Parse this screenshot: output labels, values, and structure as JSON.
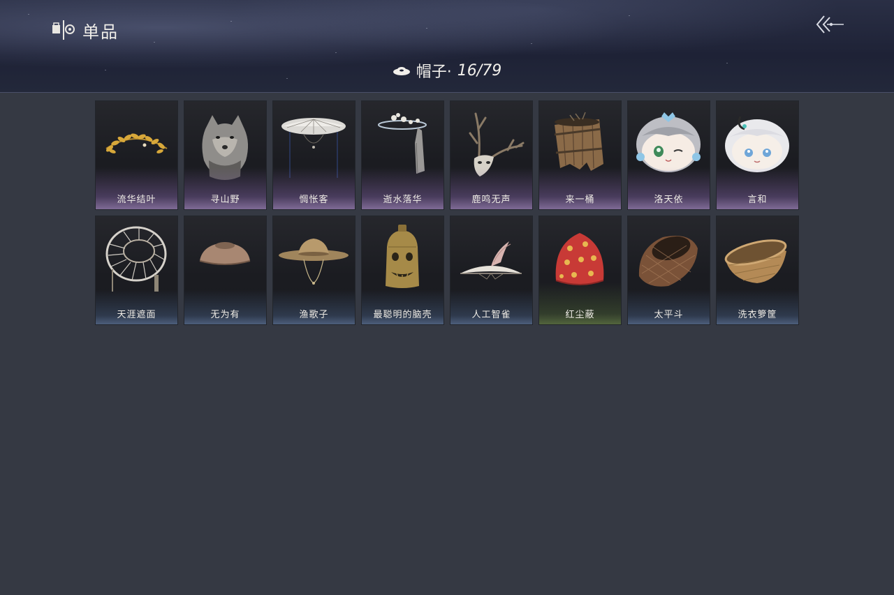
{
  "header": {
    "title": "单品",
    "title_icon": "collection-icon",
    "back_icon": "back-arrow-icon"
  },
  "category": {
    "icon": "hat-icon",
    "label": "帽子·",
    "count": "16/79"
  },
  "colors": {
    "background": "#353943",
    "card": "#1d1e23",
    "rarity_purple": "#a98cc8",
    "rarity_blue": "#6f8db8",
    "rarity_green": "#7f9a52"
  },
  "items": [
    {
      "name": "流华结叶",
      "icon": "golden-laurel-wreath-icon",
      "rarity": "purple"
    },
    {
      "name": "寻山野",
      "icon": "wolf-head-hood-icon",
      "rarity": "purple"
    },
    {
      "name": "惆怅客",
      "icon": "veiled-bamboo-hat-icon",
      "rarity": "purple"
    },
    {
      "name": "逝水落华",
      "icon": "flower-veil-hat-icon",
      "rarity": "purple"
    },
    {
      "name": "鹿鸣无声",
      "icon": "deer-skull-antler-icon",
      "rarity": "purple"
    },
    {
      "name": "来一桶",
      "icon": "wooden-bucket-icon",
      "rarity": "purple"
    },
    {
      "name": "洛天依",
      "icon": "luo-tianyi-plush-head-icon",
      "rarity": "purple"
    },
    {
      "name": "言和",
      "icon": "yan-he-plush-head-icon",
      "rarity": "purple"
    },
    {
      "name": "天涯遮面",
      "icon": "broken-wicker-hat-icon",
      "rarity": "blue"
    },
    {
      "name": "无为有",
      "icon": "clay-bowl-hat-icon",
      "rarity": "blue"
    },
    {
      "name": "渔歌子",
      "icon": "straw-fishing-hat-icon",
      "rarity": "blue"
    },
    {
      "name": "最聪明的脑壳",
      "icon": "bronze-bell-mask-icon",
      "rarity": "blue"
    },
    {
      "name": "人工智雀",
      "icon": "bird-hat-icon",
      "rarity": "blue"
    },
    {
      "name": "红尘蔽",
      "icon": "red-cloth-hood-icon",
      "rarity": "green"
    },
    {
      "name": "太平斗",
      "icon": "woven-bamboo-basket-icon",
      "rarity": "blue"
    },
    {
      "name": "洗衣箩筐",
      "icon": "laundry-basket-icon",
      "rarity": "blue"
    }
  ]
}
